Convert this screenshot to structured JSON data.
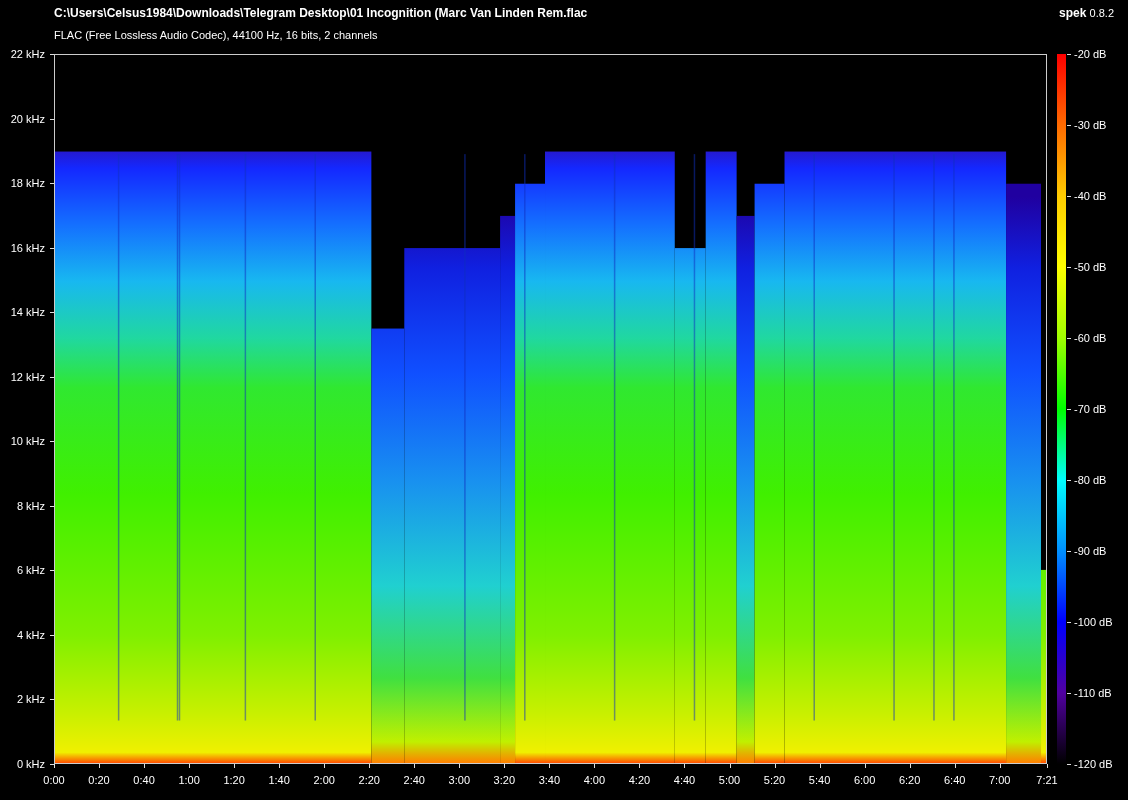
{
  "header": {
    "file_path": "C:\\Users\\Celsus1984\\Downloads\\Telegram Desktop\\01 Incognition (Marc Van Linden Rem.flac",
    "stream_info": "FLAC (Free Lossless Audio Codec), 44100 Hz, 16 bits, 2 channels",
    "brand": "spek",
    "version": "0.8.2"
  },
  "frequency_axis": {
    "ticks": [
      "22 kHz",
      "20 kHz",
      "18 kHz",
      "16 kHz",
      "14 kHz",
      "12 kHz",
      "10 kHz",
      "8 kHz",
      "6 kHz",
      "4 kHz",
      "2 kHz",
      "0 kHz"
    ]
  },
  "time_axis": {
    "ticks": [
      "0:00",
      "0:20",
      "0:40",
      "1:00",
      "1:20",
      "1:40",
      "2:00",
      "2:20",
      "2:40",
      "3:00",
      "3:20",
      "3:40",
      "4:00",
      "4:20",
      "4:40",
      "5:00",
      "5:20",
      "5:40",
      "6:00",
      "6:20",
      "6:40",
      "7:00",
      "7:21"
    ]
  },
  "color_scale": {
    "ticks": [
      "-20 dB",
      "-30 dB",
      "-40 dB",
      "-50 dB",
      "-60 dB",
      "-70 dB",
      "-80 dB",
      "-90 dB",
      "-100 dB",
      "-110 dB",
      "-120 dB"
    ]
  }
}
